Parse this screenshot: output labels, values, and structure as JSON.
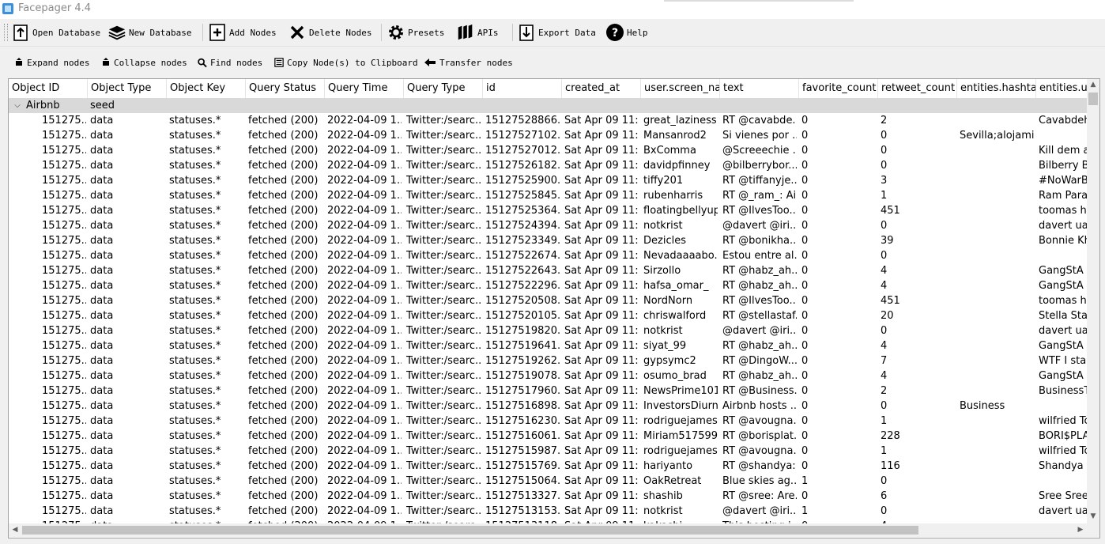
{
  "window": {
    "title": "Facepager 4.4"
  },
  "toolbar": [
    {
      "id": "open-database-button",
      "label": "Open Database",
      "icon": "open-database-icon"
    },
    {
      "id": "new-database-button",
      "label": "New Database",
      "icon": "new-database-icon"
    },
    {
      "id": "add-nodes-button",
      "label": "Add Nodes",
      "icon": "add-nodes-icon"
    },
    {
      "id": "delete-nodes-button",
      "label": "Delete Nodes",
      "icon": "delete-nodes-icon"
    },
    {
      "id": "presets-button",
      "label": "Presets",
      "icon": "gear-icon"
    },
    {
      "id": "apis-button",
      "label": "APIs",
      "icon": "apis-icon"
    },
    {
      "id": "export-data-button",
      "label": "Export Data",
      "icon": "export-icon"
    },
    {
      "id": "help-button",
      "label": "Help",
      "icon": "help-icon"
    }
  ],
  "subtoolbar": [
    {
      "id": "expand-nodes-button",
      "label": "Expand nodes",
      "icon": "expand-icon"
    },
    {
      "id": "collapse-nodes-button",
      "label": "Collapse nodes",
      "icon": "collapse-icon"
    },
    {
      "id": "find-nodes-button",
      "label": "Find nodes",
      "icon": "search-icon"
    },
    {
      "id": "copy-nodes-button",
      "label": "Copy Node(s) to Clipboard",
      "icon": "copy-icon"
    },
    {
      "id": "transfer-nodes-button",
      "label": "Transfer nodes",
      "icon": "transfer-icon"
    }
  ],
  "table": {
    "columns": [
      "Object ID",
      "Object Type",
      "Object Key",
      "Query Status",
      "Query Time",
      "Query Type",
      "id",
      "created_at",
      "user.screen_nam",
      "text",
      "favorite_count",
      "retweet_count",
      "entities.hashtag:",
      "entities.use"
    ],
    "seed": {
      "object_id": "Airbnb",
      "object_type": "seed"
    },
    "rows": [
      [
        "151275...",
        "data",
        "statuses.*",
        "fetched (200)",
        "2022-04-09 1...",
        "Twitter:/searc...",
        "15127528866...",
        "Sat Apr 09 11:...",
        "great_laziness",
        "RT @cavabde...",
        "0",
        "2",
        "",
        "Cavabdehl"
      ],
      [
        "151275...",
        "data",
        "statuses.*",
        "fetched (200)",
        "2022-04-09 1...",
        "Twitter:/searc...",
        "15127527102...",
        "Sat Apr 09 11:...",
        "Mansanrod2",
        "Si vienes por ...",
        "0",
        "0",
        "Sevilla;alojami...",
        ""
      ],
      [
        "151275...",
        "data",
        "statuses.*",
        "fetched (200)",
        "2022-04-09 1...",
        "Twitter:/searc...",
        "15127527012...",
        "Sat Apr 09 11:...",
        "BxComma",
        "@Screeechie ...",
        "0",
        "0",
        "",
        "Kill dem a"
      ],
      [
        "151275...",
        "data",
        "statuses.*",
        "fetched (200)",
        "2022-04-09 1...",
        "Twitter:/searc...",
        "15127526182...",
        "Sat Apr 09 11:...",
        "davidpfinney",
        "@bilberrybor...",
        "0",
        "0",
        "",
        "Bilberry Bo"
      ],
      [
        "151275...",
        "data",
        "statuses.*",
        "fetched (200)",
        "2022-04-09 1...",
        "Twitter:/searc...",
        "15127525900...",
        "Sat Apr 09 11:...",
        "tiffy201",
        "RT @tiffanyje...",
        "0",
        "3",
        "",
        "#NoWarBu"
      ],
      [
        "151275...",
        "data",
        "statuses.*",
        "fetched (200)",
        "2022-04-09 1...",
        "Twitter:/searc...",
        "15127525845...",
        "Sat Apr 09 11:...",
        "rubenharris",
        "RT @_ram_: Ai...",
        "0",
        "1",
        "",
        "Ram Parar"
      ],
      [
        "151275...",
        "data",
        "statuses.*",
        "fetched (200)",
        "2022-04-09 1...",
        "Twitter:/searc...",
        "15127525364...",
        "Sat Apr 09 11:...",
        "floatingbellyup",
        "RT @IlvesToo...",
        "0",
        "451",
        "",
        "toomas he"
      ],
      [
        "151275...",
        "data",
        "statuses.*",
        "fetched (200)",
        "2022-04-09 1...",
        "Twitter:/searc...",
        "15127524394...",
        "Sat Apr 09 11:...",
        "notkrist",
        "@davert @iri...",
        "0",
        "0",
        "",
        "davert ua;t"
      ],
      [
        "151275...",
        "data",
        "statuses.*",
        "fetched (200)",
        "2022-04-09 1...",
        "Twitter:/searc...",
        "15127523349...",
        "Sat Apr 09 11:...",
        "Dezicles",
        "RT @bonikha...",
        "0",
        "39",
        "",
        "Bonnie Kha"
      ],
      [
        "151275...",
        "data",
        "statuses.*",
        "fetched (200)",
        "2022-04-09 1...",
        "Twitter:/searc...",
        "15127522674...",
        "Sat Apr 09 11:...",
        "Nevadaaaabo...",
        "Estou entre al...",
        "0",
        "0",
        "",
        ""
      ],
      [
        "151275...",
        "data",
        "statuses.*",
        "fetched (200)",
        "2022-04-09 1...",
        "Twitter:/searc...",
        "15127522643...",
        "Sat Apr 09 11:...",
        "Sirzollo",
        "RT @habz_ah...",
        "0",
        "4",
        "",
        "GangStA P"
      ],
      [
        "151275...",
        "data",
        "statuses.*",
        "fetched (200)",
        "2022-04-09 1...",
        "Twitter:/searc...",
        "15127522296...",
        "Sat Apr 09 11:...",
        "hafsa_omar_",
        "RT @habz_ah...",
        "0",
        "4",
        "",
        "GangStA P"
      ],
      [
        "151275...",
        "data",
        "statuses.*",
        "fetched (200)",
        "2022-04-09 1...",
        "Twitter:/searc...",
        "15127520508...",
        "Sat Apr 09 11:...",
        "NordNorn",
        "RT @IlvesToo...",
        "0",
        "451",
        "",
        "toomas he"
      ],
      [
        "151275...",
        "data",
        "statuses.*",
        "fetched (200)",
        "2022-04-09 1...",
        "Twitter:/searc...",
        "15127520105...",
        "Sat Apr 09 11:...",
        "chriswalford",
        "RT @stellastaf...",
        "0",
        "20",
        "",
        "Stella Staff"
      ],
      [
        "151275...",
        "data",
        "statuses.*",
        "fetched (200)",
        "2022-04-09 1...",
        "Twitter:/searc...",
        "15127519820...",
        "Sat Apr 09 11:...",
        "notkrist",
        "@davert @iri...",
        "0",
        "0",
        "",
        "davert ua;t"
      ],
      [
        "151275...",
        "data",
        "statuses.*",
        "fetched (200)",
        "2022-04-09 1...",
        "Twitter:/searc...",
        "15127519641...",
        "Sat Apr 09 11:...",
        "siyat_99",
        "RT @habz_ah...",
        "0",
        "4",
        "",
        "GangStA P"
      ],
      [
        "151275...",
        "data",
        "statuses.*",
        "fetched (200)",
        "2022-04-09 1...",
        "Twitter:/searc...",
        "15127519262...",
        "Sat Apr 09 11:...",
        "gypsymc2",
        "RT @DingoW...",
        "0",
        "7",
        "",
        "WTF I stan"
      ],
      [
        "151275...",
        "data",
        "statuses.*",
        "fetched (200)",
        "2022-04-09 1...",
        "Twitter:/searc...",
        "15127519078...",
        "Sat Apr 09 11:...",
        "osumo_brad",
        "RT @habz_ah...",
        "0",
        "4",
        "",
        "GangStA P"
      ],
      [
        "151275...",
        "data",
        "statuses.*",
        "fetched (200)",
        "2022-04-09 1...",
        "Twitter:/searc...",
        "15127517960...",
        "Sat Apr 09 11:...",
        "NewsPrime1012",
        "RT @Business...",
        "0",
        "2",
        "",
        "BusinessTe"
      ],
      [
        "151275...",
        "data",
        "statuses.*",
        "fetched (200)",
        "2022-04-09 1...",
        "Twitter:/searc...",
        "15127516898...",
        "Sat Apr 09 11:...",
        "InvestorsDiurn1",
        "Airbnb hosts ...",
        "0",
        "0",
        "Business",
        ""
      ],
      [
        "151275...",
        "data",
        "statuses.*",
        "fetched (200)",
        "2022-04-09 1...",
        "Twitter:/searc...",
        "15127516230...",
        "Sat Apr 09 11:...",
        "rodriguejames",
        "RT @avougna...",
        "0",
        "1",
        "",
        "wilfried Tcl"
      ],
      [
        "151275...",
        "data",
        "statuses.*",
        "fetched (200)",
        "2022-04-09 1...",
        "Twitter:/searc...",
        "15127516061...",
        "Sat Apr 09 11:...",
        "Miriam517599...",
        "RT @borisplat...",
        "0",
        "228",
        "",
        "BORI$PLAT"
      ],
      [
        "151275...",
        "data",
        "statuses.*",
        "fetched (200)",
        "2022-04-09 1...",
        "Twitter:/searc...",
        "15127515987...",
        "Sat Apr 09 11:...",
        "rodriguejames",
        "RT @avougna...",
        "0",
        "1",
        "",
        "wilfried Tcl"
      ],
      [
        "151275...",
        "data",
        "statuses.*",
        "fetched (200)",
        "2022-04-09 1...",
        "Twitter:/searc...",
        "15127515769...",
        "Sat Apr 09 11:...",
        "hariyanto",
        "RT @shandya:...",
        "0",
        "116",
        "",
        "Shandya"
      ],
      [
        "151275...",
        "data",
        "statuses.*",
        "fetched (200)",
        "2022-04-09 1...",
        "Twitter:/searc...",
        "15127515064...",
        "Sat Apr 09 11:...",
        "OakRetreat",
        "Blue skies ag...",
        "1",
        "0",
        "",
        ""
      ],
      [
        "151275...",
        "data",
        "statuses.*",
        "fetched (200)",
        "2022-04-09 1...",
        "Twitter:/searc...",
        "15127513327...",
        "Sat Apr 09 11:...",
        "shashib",
        "RT @sree: Are...",
        "0",
        "6",
        "",
        "Sree Sreer"
      ],
      [
        "151275...",
        "data",
        "statuses.*",
        "fetched (200)",
        "2022-04-09 1...",
        "Twitter:/searc...",
        "15127513153...",
        "Sat Apr 09 11:...",
        "notkrist",
        "@davert @iri...",
        "1",
        "0",
        "",
        "davert ua;t"
      ],
      [
        "151275...",
        "data",
        "statuses.*",
        "fetched (200)",
        "2022-04-09 1...",
        "Twitter:/searc...",
        "15127513118...",
        "Sat Apr 09 11:...",
        "kakashi",
        "This hosting i...",
        "0",
        "4",
        "",
        ""
      ]
    ]
  }
}
